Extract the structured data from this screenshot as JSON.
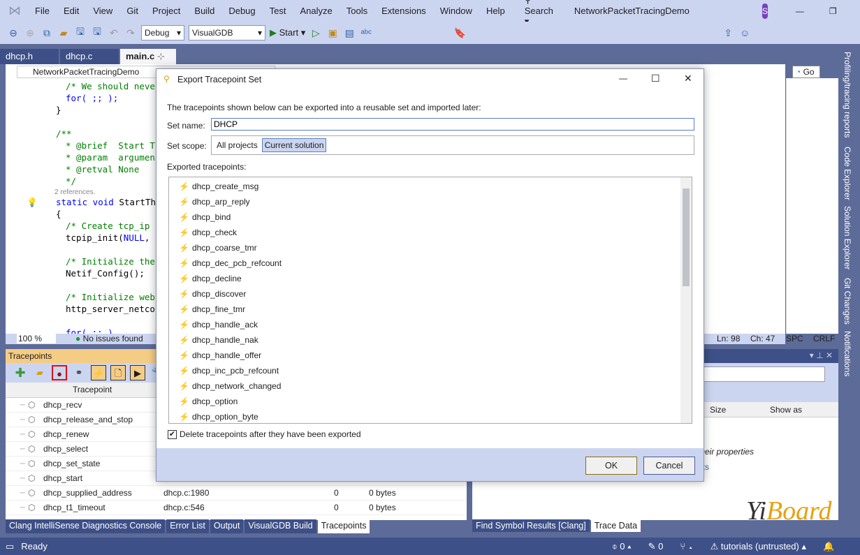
{
  "menu": [
    "File",
    "Edit",
    "View",
    "Git",
    "Project",
    "Build",
    "Debug",
    "Test",
    "Analyze",
    "Tools",
    "Extensions",
    "Window",
    "Help"
  ],
  "search_label": "Search",
  "window_title": "NetworkPacketTracingDemo",
  "user_initial": "S",
  "toolbar": {
    "config": "Debug",
    "platform": "VisualGDB",
    "start": "Start"
  },
  "tabs": [
    "dhcp.h",
    "dhcp.c",
    "main.c"
  ],
  "navbar": {
    "project": "NetworkPacketTracingDemo",
    "go": "Go"
  },
  "code": {
    "l1": "/* We should neve",
    "l2": "for( ;; );",
    "l3": "}",
    "l4": "/**",
    "l5": "* @brief  Start T",
    "l6": "* @param  argumen",
    "l7": "* @retval None",
    "l8": "*/",
    "refs": "2 references.",
    "l9a": "static void",
    "l9b": "StartTh",
    "l10": "{",
    "l11": "/* Create tcp_ip",
    "l12a": "tcpip_init(",
    "l12b": "NULL",
    ",": ",",
    "l13": "/* Initialize the",
    "l14": "Netif_Config();",
    "l15": "/* Initialize web",
    "l16": "http_server_netco",
    "l17": "for( ;; )"
  },
  "editor_status": {
    "zoom": "100 %",
    "issues": "No issues found",
    "ln": "Ln: 98",
    "ch": "Ch: 47",
    "spc": "SPC",
    "crlf": "CRLF"
  },
  "right_strip": [
    "Profiling/tracing reports",
    "Code Explorer",
    "Solution Explorer",
    "Git Changes",
    "Notifications"
  ],
  "tracepoints_panel": {
    "title": "Tracepoints",
    "column": "Tracepoint",
    "rows": [
      {
        "name": "dhcp_recv"
      },
      {
        "name": "dhcp_release_and_stop"
      },
      {
        "name": "dhcp_renew"
      },
      {
        "name": "dhcp_select"
      },
      {
        "name": "dhcp_set_state"
      },
      {
        "name": "dhcp_start"
      },
      {
        "name": "dhcp_supplied_address",
        "loc": "dhcp.c:1980",
        "count": "0",
        "size": "0 bytes"
      },
      {
        "name": "dhcp_t1_timeout",
        "loc": "dhcp.c:546",
        "count": "0",
        "size": "0 bytes"
      }
    ]
  },
  "trace_panel": {
    "col_size": "Size",
    "col_show": "Show as",
    "hint": "their properties",
    "link": "nts"
  },
  "bottom_tabs_left": [
    "Clang IntelliSense Diagnostics Console",
    "Error List",
    "Output",
    "VisualGDB Build",
    "Tracepoints"
  ],
  "bottom_tabs_right": [
    "Find Symbol Results [Clang]",
    "Trace Data"
  ],
  "status": {
    "ready": "Ready",
    "commits": "0",
    "edits": "0",
    "repo": "tutorials (untrusted)"
  },
  "dialog": {
    "title": "Export Tracepoint Set",
    "intro": "The tracepoints shown below can be exported into a reusable set and imported later:",
    "set_name_label": "Set name:",
    "set_name_value": "DHCP",
    "scope_label": "Set scope:",
    "scope_options": [
      "All projects",
      "Current solution"
    ],
    "scope_selected": "Current solution",
    "exported_label": "Exported tracepoints:",
    "tracepoints": [
      "dhcp_create_msg",
      "dhcp_arp_reply",
      "dhcp_bind",
      "dhcp_check",
      "dhcp_coarse_tmr",
      "dhcp_dec_pcb_refcount",
      "dhcp_decline",
      "dhcp_discover",
      "dhcp_fine_tmr",
      "dhcp_handle_ack",
      "dhcp_handle_nak",
      "dhcp_handle_offer",
      "dhcp_inc_pcb_refcount",
      "dhcp_network_changed",
      "dhcp_option",
      "dhcp_option_byte"
    ],
    "delete_label": "Delete tracepoints after they have been exported",
    "delete_checked": true,
    "ok": "OK",
    "cancel": "Cancel"
  },
  "watermark": "YiBoard"
}
